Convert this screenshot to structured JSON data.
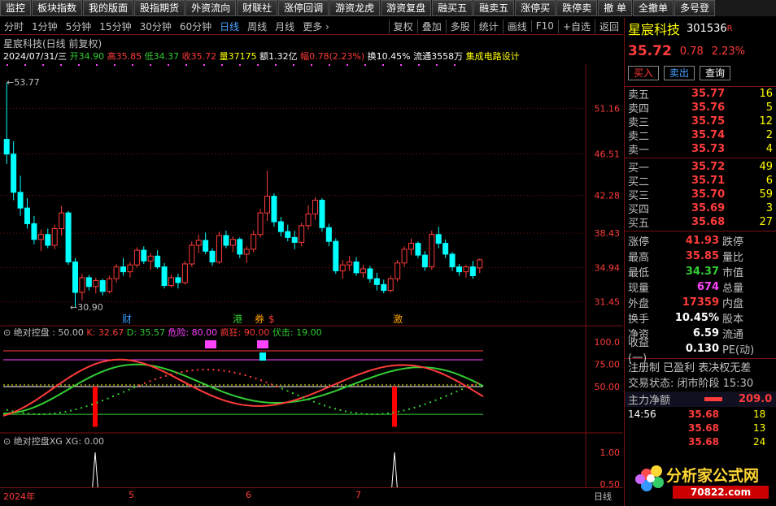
{
  "toolbar": [
    "监控",
    "板块指数",
    "我的版面",
    "股指期货",
    "外资流向",
    "财联社",
    "涨停回调",
    "游资龙虎",
    "游资复盘",
    "融买五",
    "融卖五",
    "涨停买",
    "跌停卖",
    "撤 单",
    "全撤单",
    "多号登"
  ],
  "periods": [
    "分时",
    "1分钟",
    "5分钟",
    "15分钟",
    "30分钟",
    "60分钟",
    "日线",
    "周线",
    "月线",
    "更多 ›"
  ],
  "active_period": "日线",
  "right_tools": [
    "复权",
    "叠加",
    "多股",
    "统计",
    "画线",
    "F10",
    "+自选",
    "返回"
  ],
  "chart": {
    "title": "星宸科技(日线 前复权)",
    "date": "2024/07/31/三",
    "open_label": "开",
    "open": "34.90",
    "high_label": "高",
    "high": "35.85",
    "low_label": "低",
    "low": "34.37",
    "close_label": "收",
    "close": "35.72",
    "vol_label": "量",
    "vol": "37175",
    "amt_label": "额",
    "amt": "1.32亿",
    "pct_label": "幅",
    "pct": "0.78(2.23%)",
    "turnover_label": "换",
    "turnover": "10.45%",
    "float_label": "流通",
    "float": "3558万",
    "concept": "集成电路设计",
    "max_label": "53.77",
    "min_label": "30.90",
    "price_ticks": [
      "51.16",
      "46.51",
      "42.28",
      "38.43",
      "34.94",
      "31.45"
    ],
    "markers": [
      "财",
      "港",
      "券",
      "$",
      "激"
    ]
  },
  "chart_data": {
    "type": "candlestick",
    "ohlc": [
      [
        48.0,
        53.77,
        45.5,
        46.5
      ],
      [
        46.5,
        47.8,
        41.8,
        42.6
      ],
      [
        42.6,
        44.3,
        40.2,
        41.0
      ],
      [
        41.0,
        42.0,
        38.9,
        39.4
      ],
      [
        39.4,
        40.2,
        37.3,
        37.8
      ],
      [
        37.8,
        38.8,
        36.6,
        38.3
      ],
      [
        38.3,
        38.9,
        36.9,
        37.2
      ],
      [
        37.2,
        39.3,
        36.8,
        38.9
      ],
      [
        38.9,
        41.2,
        38.2,
        40.5
      ],
      [
        40.5,
        40.7,
        35.2,
        35.5
      ],
      [
        35.5,
        35.9,
        30.9,
        32.4
      ],
      [
        32.4,
        34.3,
        31.6,
        33.9
      ],
      [
        33.9,
        34.2,
        32.6,
        33.0
      ],
      [
        33.0,
        33.9,
        32.3,
        33.6
      ],
      [
        33.6,
        33.8,
        32.1,
        32.5
      ],
      [
        32.5,
        34.1,
        32.3,
        33.8
      ],
      [
        33.8,
        35.3,
        33.4,
        35.0
      ],
      [
        35.0,
        35.9,
        34.1,
        34.5
      ],
      [
        34.5,
        35.5,
        33.9,
        35.2
      ],
      [
        35.2,
        37.0,
        34.9,
        36.7
      ],
      [
        36.7,
        37.1,
        35.3,
        35.6
      ],
      [
        35.6,
        36.4,
        34.7,
        36.1
      ],
      [
        36.1,
        36.7,
        34.8,
        35.0
      ],
      [
        35.0,
        35.4,
        32.8,
        33.1
      ],
      [
        33.1,
        34.2,
        32.9,
        33.9
      ],
      [
        33.9,
        34.3,
        32.8,
        33.4
      ],
      [
        33.4,
        35.6,
        33.2,
        35.3
      ],
      [
        35.3,
        37.6,
        35.0,
        37.2
      ],
      [
        37.2,
        38.3,
        36.4,
        37.7
      ],
      [
        37.7,
        38.5,
        36.3,
        36.6
      ],
      [
        36.6,
        36.9,
        35.1,
        35.5
      ],
      [
        35.5,
        38.6,
        35.3,
        38.2
      ],
      [
        38.2,
        38.7,
        36.9,
        37.2
      ],
      [
        37.2,
        38.1,
        36.5,
        37.8
      ],
      [
        37.8,
        38.0,
        35.9,
        36.3
      ],
      [
        36.3,
        37.1,
        35.4,
        36.8
      ],
      [
        36.8,
        38.7,
        36.5,
        38.3
      ],
      [
        38.3,
        40.9,
        38.0,
        40.5
      ],
      [
        40.5,
        44.8,
        39.7,
        42.2
      ],
      [
        42.2,
        42.5,
        39.1,
        39.6
      ],
      [
        39.6,
        40.1,
        38.1,
        38.6
      ],
      [
        38.6,
        39.3,
        37.6,
        38.0
      ],
      [
        38.0,
        38.7,
        36.8,
        37.5
      ],
      [
        37.5,
        39.5,
        37.1,
        39.2
      ],
      [
        39.2,
        41.3,
        38.8,
        40.4
      ],
      [
        40.4,
        42.1,
        39.8,
        41.8
      ],
      [
        41.8,
        42.0,
        38.6,
        39.0
      ],
      [
        39.0,
        39.4,
        37.1,
        37.6
      ],
      [
        37.6,
        37.9,
        34.3,
        34.6
      ],
      [
        34.6,
        35.7,
        33.8,
        35.2
      ],
      [
        35.2,
        36.1,
        34.6,
        35.5
      ],
      [
        35.5,
        36.0,
        34.1,
        34.4
      ],
      [
        34.4,
        35.2,
        33.9,
        34.8
      ],
      [
        34.8,
        35.1,
        33.4,
        33.8
      ],
      [
        33.8,
        34.4,
        32.6,
        33.2
      ],
      [
        33.2,
        33.7,
        32.3,
        32.6
      ],
      [
        32.6,
        34.1,
        32.4,
        33.8
      ],
      [
        33.8,
        35.7,
        33.5,
        35.4
      ],
      [
        35.4,
        37.1,
        35.0,
        36.8
      ],
      [
        36.8,
        37.9,
        36.2,
        37.4
      ],
      [
        37.4,
        37.6,
        35.9,
        36.2
      ],
      [
        36.2,
        36.6,
        34.6,
        35.0
      ],
      [
        35.0,
        38.7,
        34.7,
        38.3
      ],
      [
        38.3,
        39.1,
        36.9,
        37.4
      ],
      [
        37.4,
        37.8,
        35.9,
        36.3
      ],
      [
        36.3,
        36.5,
        34.6,
        35.0
      ],
      [
        35.0,
        35.3,
        34.1,
        34.5
      ],
      [
        34.5,
        35.2,
        33.9,
        35.0
      ],
      [
        35.0,
        35.6,
        33.8,
        34.1
      ],
      [
        34.9,
        35.85,
        34.37,
        35.72
      ]
    ],
    "ylim": [
      30.9,
      53.77
    ]
  },
  "indicator1": {
    "name": "绝对控盘",
    "param": ": 50.00",
    "k_label": "K:",
    "k": "32.67",
    "d_label": "D:",
    "d": "35.57",
    "danger_label": "危险:",
    "danger": "80.00",
    "crazy_label": "疯狂:",
    "crazy": "90.00",
    "ambush_label": "伏击:",
    "ambush": "19.00",
    "ticks": [
      "100.0",
      "75.00",
      "50.00"
    ]
  },
  "indicator2": {
    "name": "绝对控盘XG",
    "xg_label": "XG:",
    "xg": "0.00",
    "ticks": [
      "1.00",
      "0.50"
    ]
  },
  "xaxis": {
    "labels": [
      "2024年",
      "5",
      "6",
      "7"
    ],
    "right": "日线"
  },
  "panel": {
    "name": "星宸科技",
    "code": "301536",
    "code_mark": "R",
    "price": "35.72",
    "change": "0.78",
    "pct": "2.23%",
    "buy": "买入",
    "sell": "卖出",
    "query": "查询",
    "asks": [
      {
        "label": "卖五",
        "price": "35.77",
        "vol": "16"
      },
      {
        "label": "卖四",
        "price": "35.76",
        "vol": "5"
      },
      {
        "label": "卖三",
        "price": "35.75",
        "vol": "12"
      },
      {
        "label": "卖二",
        "price": "35.74",
        "vol": "2"
      },
      {
        "label": "卖一",
        "price": "35.73",
        "vol": "4"
      }
    ],
    "bids": [
      {
        "label": "买一",
        "price": "35.72",
        "vol": "49"
      },
      {
        "label": "买二",
        "price": "35.71",
        "vol": "6"
      },
      {
        "label": "买三",
        "price": "35.70",
        "vol": "59"
      },
      {
        "label": "买四",
        "price": "35.69",
        "vol": "3"
      },
      {
        "label": "买五",
        "price": "35.68",
        "vol": "27"
      }
    ],
    "stats": [
      {
        "l": "涨停",
        "v": "41.93",
        "c": "red",
        "l2": "跌停"
      },
      {
        "l": "最高",
        "v": "35.85",
        "c": "red",
        "l2": "量比"
      },
      {
        "l": "最低",
        "v": "34.37",
        "c": "green",
        "l2": "市值"
      },
      {
        "l": "现量",
        "v": "674",
        "c": "magenta",
        "l2": "总量"
      },
      {
        "l": "外盘",
        "v": "17359",
        "c": "red",
        "l2": "内盘"
      },
      {
        "l": "换手",
        "v": "10.45%",
        "c": "white",
        "l2": "股本"
      },
      {
        "l": "净资",
        "v": "6.59",
        "c": "white",
        "l2": "流通"
      },
      {
        "l": "收益(一)",
        "v": "0.130",
        "c": "white",
        "l2": "PE(动)"
      }
    ],
    "reg": "注册制 已盈利 表决权无差",
    "trade_state": "交易状态: 闭市阶段 15:30",
    "flow_label": "主力净额",
    "flow_value": "209.0",
    "ticks": [
      {
        "t": "14:56",
        "p": "35.68",
        "v": "18"
      },
      {
        "t": "",
        "p": "35.68",
        "v": "13"
      },
      {
        "t": "",
        "p": "35.68",
        "v": "24"
      }
    ],
    "logo_text": "分析家公式网",
    "logo_url": "70822.com"
  }
}
